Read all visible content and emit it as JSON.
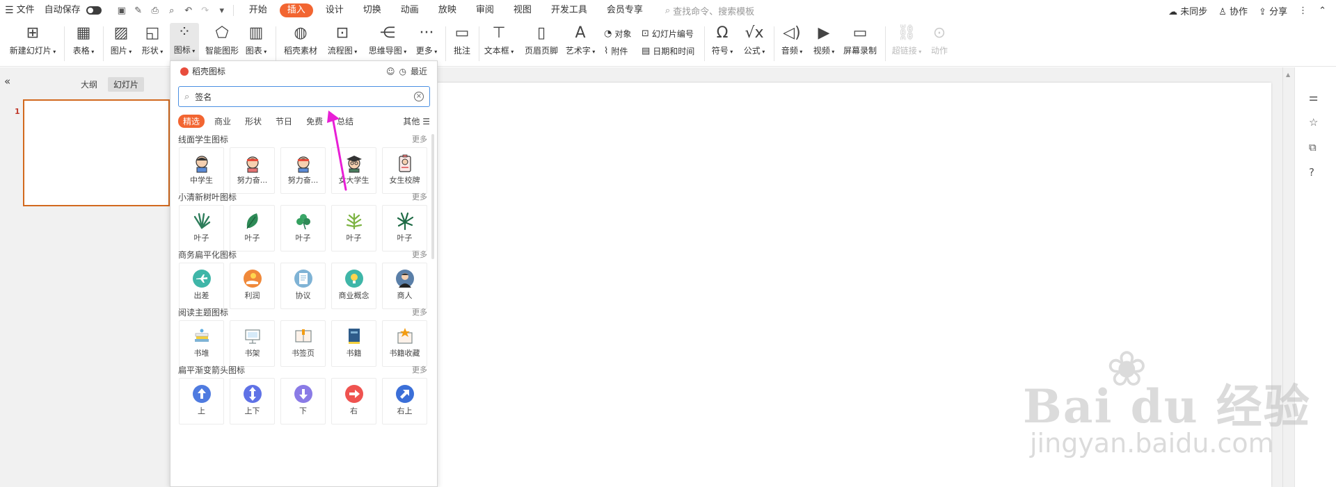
{
  "menubar": {
    "file": "文件",
    "autosave": "自动保存",
    "tabs": [
      "开始",
      "插入",
      "设计",
      "切换",
      "动画",
      "放映",
      "审阅",
      "视图",
      "开发工具",
      "会员专享"
    ],
    "active_tab": "插入",
    "search_placeholder": "查找命令、搜索模板",
    "right": {
      "unsynced": "未同步",
      "collab": "协作",
      "share": "分享"
    }
  },
  "ribbon": {
    "new_slide": "新建幻灯片",
    "table": "表格",
    "picture": "图片",
    "shape": "形状",
    "icon": "图标",
    "smartart": "智能图形",
    "chart": "图表",
    "material": "稻壳素材",
    "flowchart": "流程图",
    "mindmap": "思维导图",
    "more": "更多",
    "comment": "批注",
    "textbox": "文本框",
    "header_footer": "页眉页脚",
    "wordart": "艺术字",
    "object": "对象",
    "slide_number": "幻灯片编号",
    "attachment": "附件",
    "datetime": "日期和时间",
    "symbol": "符号",
    "formula": "公式",
    "audio": "音频",
    "video": "视频",
    "screen_record": "屏幕录制",
    "hyperlink": "超链接",
    "action": "动作"
  },
  "leftpanel": {
    "outline": "大纲",
    "slides": "幻灯片",
    "slide_number": "1"
  },
  "iconpanel": {
    "title": "稻壳图标",
    "recent": "最近",
    "search_value": "签名",
    "filters": [
      "精选",
      "商业",
      "形状",
      "节日",
      "免费",
      "总结"
    ],
    "other": "其他",
    "more": "更多",
    "sections": [
      {
        "title": "线面学生图标",
        "items": [
          "中学生",
          "努力奋...",
          "努力奋...",
          "女大学生",
          "女生校牌"
        ]
      },
      {
        "title": "小清新树叶图标",
        "items": [
          "叶子",
          "叶子",
          "叶子",
          "叶子",
          "叶子"
        ]
      },
      {
        "title": "商务扁平化图标",
        "items": [
          "出差",
          "利润",
          "协议",
          "商业概念",
          "商人"
        ]
      },
      {
        "title": "阅读主题图标",
        "items": [
          "书堆",
          "书架",
          "书签页",
          "书籍",
          "书籍收藏"
        ]
      },
      {
        "title": "扁平渐变箭头图标",
        "items": [
          "上",
          "上下",
          "下",
          "右",
          "右上"
        ]
      }
    ]
  },
  "watermark": {
    "main": "Bai du 经验",
    "sub": "jingyan.baidu.com"
  },
  "colors": {
    "accent": "#f26531",
    "arrow": "#e81fd6",
    "search_border": "#4a90e2"
  }
}
